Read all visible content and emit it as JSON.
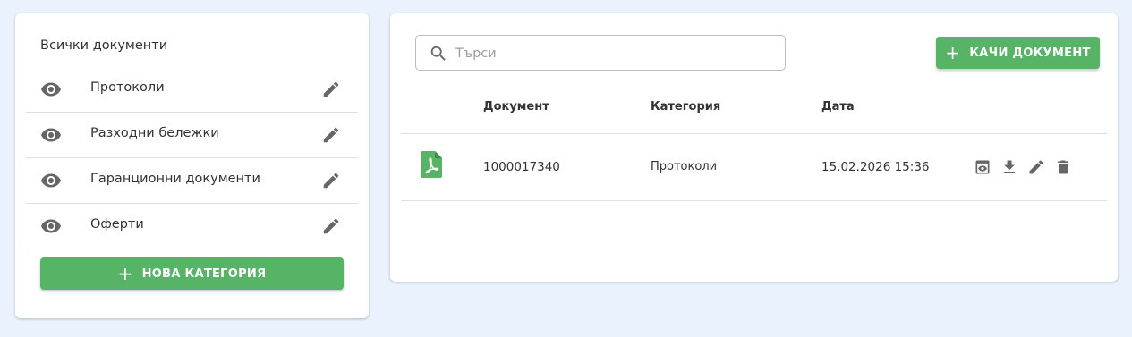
{
  "sidebar": {
    "title": "Всички документи",
    "categories": [
      {
        "label": "Протоколи"
      },
      {
        "label": "Разходни бележки"
      },
      {
        "label": "Гаранционни документи"
      },
      {
        "label": "Оферти"
      }
    ],
    "new_category_label": "НОВА КАТЕГОРИЯ",
    "new_category_icon": "+"
  },
  "main": {
    "search": {
      "placeholder": "Търси",
      "value": ""
    },
    "upload_label": "КАЧИ ДОКУМЕНТ",
    "upload_icon": "+",
    "table": {
      "headers": [
        "Документ",
        "Категория",
        "Дата"
      ],
      "rows": [
        {
          "document": "1000017340",
          "category": "Протоколи",
          "date": "15.02.2026 15:36"
        }
      ]
    }
  },
  "colors": {
    "accent": "#57b466",
    "icon": "#666666",
    "background": "#eaf3fd"
  },
  "icons": [
    "eye-icon",
    "pencil-icon",
    "search-icon",
    "pdf-icon",
    "preview-icon",
    "download-icon",
    "delete-icon"
  ]
}
